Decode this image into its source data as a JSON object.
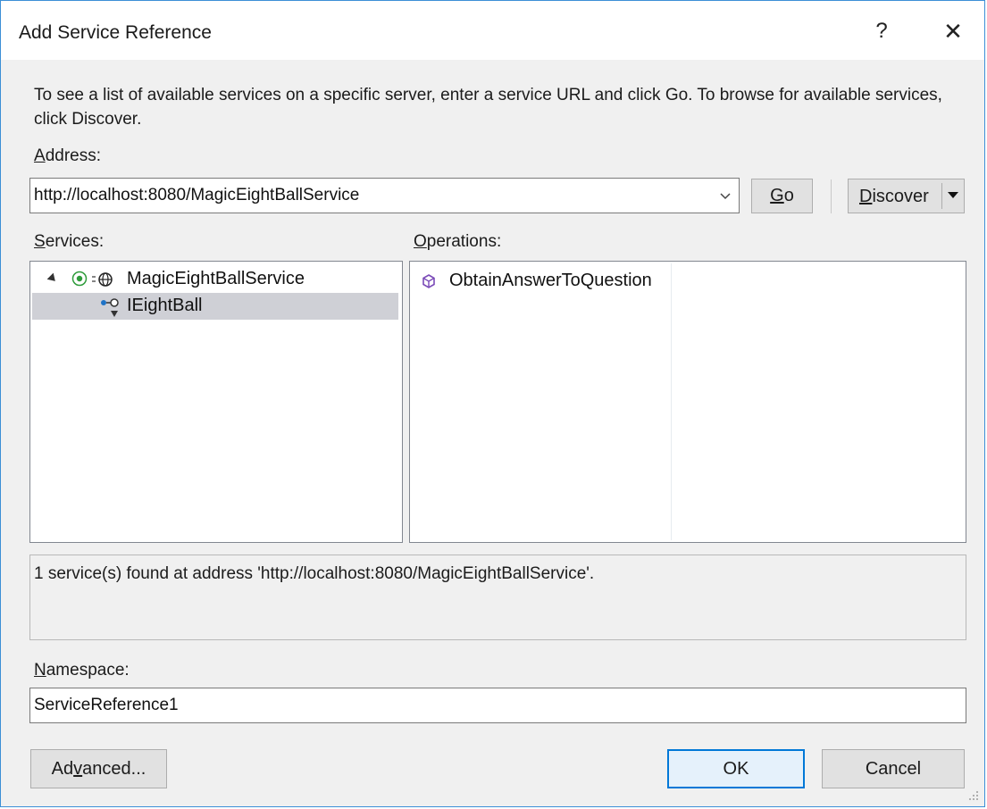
{
  "window": {
    "title": "Add Service Reference",
    "help_label": "?",
    "close_label": "✕"
  },
  "instructions": "To see a list of available services on a specific server, enter a service URL and click Go. To browse for available services, click Discover.",
  "address": {
    "label_mnemonic": "A",
    "label_rest": "ddress:",
    "value": "http://localhost:8080/MagicEightBallService"
  },
  "buttons": {
    "go_mnemonic": "G",
    "go_rest": "o",
    "discover_mnemonic": "D",
    "discover_rest": "iscover",
    "advanced_before": "Ad",
    "advanced_mnemonic": "v",
    "advanced_after": "anced...",
    "ok": "OK",
    "cancel": "Cancel"
  },
  "services": {
    "label_mnemonic": "S",
    "label_rest": "ervices:",
    "tree": [
      {
        "name": "MagicEightBallService",
        "icon": "service-globe-icon",
        "expanded": true
      },
      {
        "name": "IEightBall",
        "icon": "interface-contract-icon",
        "selected": true
      }
    ]
  },
  "operations": {
    "label_mnemonic": "O",
    "label_rest": "perations:",
    "items": [
      {
        "name": "ObtainAnswerToQuestion",
        "icon": "operation-cube-icon"
      }
    ]
  },
  "status": "1 service(s) found at address 'http://localhost:8080/MagicEightBallService'.",
  "namespace": {
    "label_mnemonic": "N",
    "label_rest": "amespace:",
    "value": "ServiceReference1"
  },
  "colors": {
    "window_border": "#3c8fd6",
    "dialog_bg": "#f0f0f0",
    "selection_bg": "#cfd0d6",
    "default_button_border": "#0078d7",
    "operation_icon": "#7b4bb8",
    "status_icon": "#2e9b3a"
  }
}
